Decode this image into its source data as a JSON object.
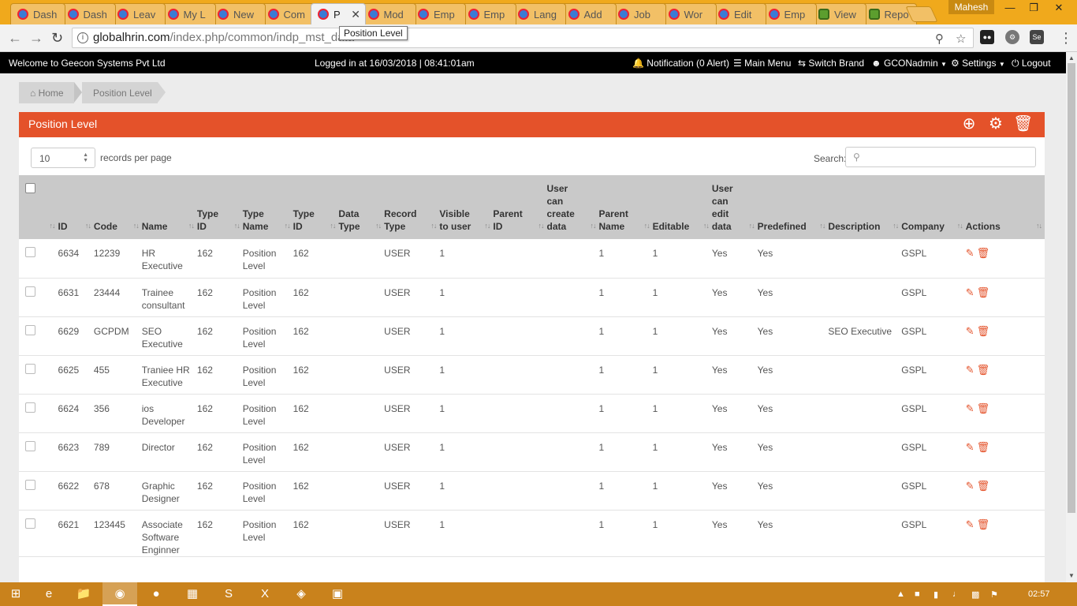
{
  "browser": {
    "tabs": [
      {
        "label": "Dash",
        "favicon": "geecon-favicon"
      },
      {
        "label": "Dash",
        "favicon": "geecon-favicon"
      },
      {
        "label": "Leav",
        "favicon": "geecon-favicon"
      },
      {
        "label": "My L",
        "favicon": "geecon-favicon"
      },
      {
        "label": "New",
        "favicon": "geecon-favicon"
      },
      {
        "label": "Com",
        "favicon": "geecon-favicon"
      },
      {
        "label": "P",
        "favicon": "geecon-favicon",
        "active": true
      },
      {
        "label": "Mod",
        "favicon": "geecon-favicon"
      },
      {
        "label": "Emp",
        "favicon": "geecon-favicon"
      },
      {
        "label": "Emp",
        "favicon": "geecon-favicon"
      },
      {
        "label": "Lang",
        "favicon": "geecon-favicon"
      },
      {
        "label": "Add",
        "favicon": "geecon-favicon"
      },
      {
        "label": "Job",
        "favicon": "geecon-favicon"
      },
      {
        "label": "Wor",
        "favicon": "geecon-favicon"
      },
      {
        "label": "Edit",
        "favicon": "geecon-favicon"
      },
      {
        "label": "Emp",
        "favicon": "geecon-favicon"
      },
      {
        "label": "View",
        "favicon": "frog-favicon"
      },
      {
        "label": "Repo",
        "favicon": "frog-favicon"
      }
    ],
    "profile_name": "Mahesh",
    "url_host": "globalhrin.com",
    "url_path": "/index.php/common/indp_mst_data",
    "tooltip": "Position Level",
    "ext_label": "Se"
  },
  "app": {
    "welcome": "Welcome to Geecon Systems Pvt Ltd",
    "logged_in": "Logged in at 16/03/2018 | 08:41:01am",
    "notification": "Notification (0 Alert)",
    "main_menu": "Main Menu",
    "switch_brand": "Switch Brand",
    "user": "GCONadmin",
    "settings": "Settings",
    "logout": "Logout"
  },
  "breadcrumb": {
    "home": "Home",
    "current": "Position Level"
  },
  "panel": {
    "title": "Position Level",
    "records_per_page_value": "10",
    "records_per_page_label": "records per page",
    "search_label": "Search:"
  },
  "table": {
    "columns": [
      "",
      "ID",
      "Code",
      "Name",
      "Type ID",
      "Type Name",
      "Type ID",
      "Data Type",
      "Record Type",
      "Visible to user",
      "Parent ID",
      "User can create data",
      "Parent Name",
      "Editable",
      "User can edit data",
      "Predefined",
      "Description",
      "Company",
      "Actions"
    ],
    "rows": [
      {
        "id": "6634",
        "code": "12239",
        "name": "HR Executive",
        "type_id": "162",
        "type_name": "Position Level",
        "type_id2": "162",
        "data_type": "",
        "record_type": "USER",
        "visible": "1",
        "parent_id": "",
        "can_create": "",
        "parent_name": "1",
        "editable": "1",
        "can_edit": "Yes",
        "predefined": "Yes",
        "description": "",
        "company": "GSPL"
      },
      {
        "id": "6631",
        "code": "23444",
        "name": "Trainee consultant",
        "type_id": "162",
        "type_name": "Position Level",
        "type_id2": "162",
        "data_type": "",
        "record_type": "USER",
        "visible": "1",
        "parent_id": "",
        "can_create": "",
        "parent_name": "1",
        "editable": "1",
        "can_edit": "Yes",
        "predefined": "Yes",
        "description": "",
        "company": "GSPL"
      },
      {
        "id": "6629",
        "code": "GCPDM",
        "name": "SEO Executive",
        "type_id": "162",
        "type_name": "Position Level",
        "type_id2": "162",
        "data_type": "",
        "record_type": "USER",
        "visible": "1",
        "parent_id": "",
        "can_create": "",
        "parent_name": "1",
        "editable": "1",
        "can_edit": "Yes",
        "predefined": "Yes",
        "description": "SEO Executive",
        "company": "GSPL"
      },
      {
        "id": "6625",
        "code": "455",
        "name": "Traniee HR Executive",
        "type_id": "162",
        "type_name": "Position Level",
        "type_id2": "162",
        "data_type": "",
        "record_type": "USER",
        "visible": "1",
        "parent_id": "",
        "can_create": "",
        "parent_name": "1",
        "editable": "1",
        "can_edit": "Yes",
        "predefined": "Yes",
        "description": "",
        "company": "GSPL"
      },
      {
        "id": "6624",
        "code": "356",
        "name": "ios Developer",
        "type_id": "162",
        "type_name": "Position Level",
        "type_id2": "162",
        "data_type": "",
        "record_type": "USER",
        "visible": "1",
        "parent_id": "",
        "can_create": "",
        "parent_name": "1",
        "editable": "1",
        "can_edit": "Yes",
        "predefined": "Yes",
        "description": "",
        "company": "GSPL"
      },
      {
        "id": "6623",
        "code": "789",
        "name": "Director",
        "type_id": "162",
        "type_name": "Position Level",
        "type_id2": "162",
        "data_type": "",
        "record_type": "USER",
        "visible": "1",
        "parent_id": "",
        "can_create": "",
        "parent_name": "1",
        "editable": "1",
        "can_edit": "Yes",
        "predefined": "Yes",
        "description": "",
        "company": "GSPL"
      },
      {
        "id": "6622",
        "code": "678",
        "name": "Graphic Designer",
        "type_id": "162",
        "type_name": "Position Level",
        "type_id2": "162",
        "data_type": "",
        "record_type": "USER",
        "visible": "1",
        "parent_id": "",
        "can_create": "",
        "parent_name": "1",
        "editable": "1",
        "can_edit": "Yes",
        "predefined": "Yes",
        "description": "",
        "company": "GSPL"
      },
      {
        "id": "6621",
        "code": "123445",
        "name": "Associate Software Enginner",
        "type_id": "162",
        "type_name": "Position Level",
        "type_id2": "162",
        "data_type": "",
        "record_type": "USER",
        "visible": "1",
        "parent_id": "",
        "can_create": "",
        "parent_name": "1",
        "editable": "1",
        "can_edit": "Yes",
        "predefined": "Yes",
        "description": "",
        "company": "GSPL"
      }
    ]
  },
  "taskbar": {
    "clock": "02:57"
  },
  "colors": {
    "accent": "#e4522a",
    "taskbar": "#c9821c",
    "tabstrip": "#f0a91c"
  }
}
